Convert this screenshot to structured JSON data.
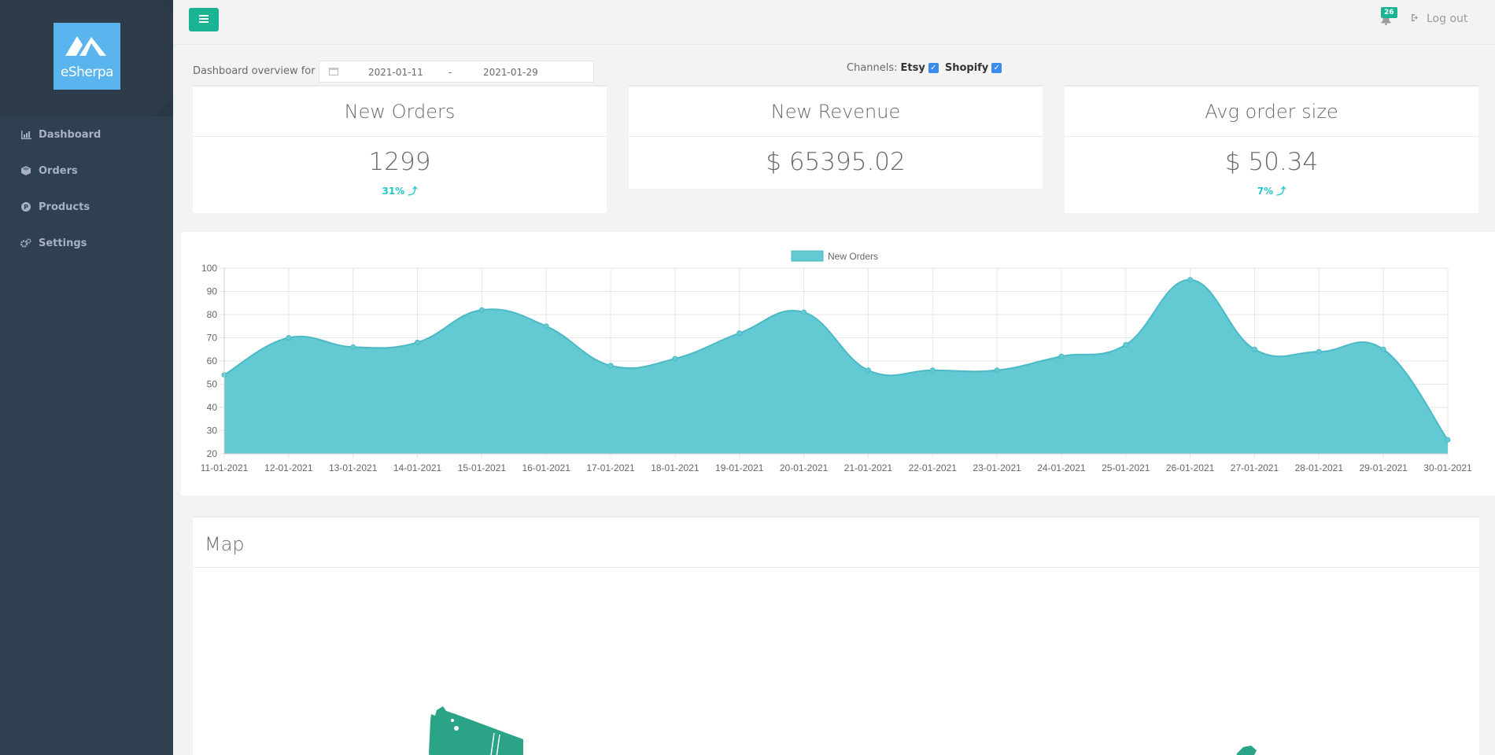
{
  "app": {
    "logo_text": "eSherpa"
  },
  "sidebar": {
    "items": [
      {
        "label": "Dashboard",
        "icon": "bar-chart-icon"
      },
      {
        "label": "Orders",
        "icon": "cube-icon"
      },
      {
        "label": "Products",
        "icon": "product-icon"
      },
      {
        "label": "Settings",
        "icon": "gears-icon"
      }
    ]
  },
  "topbar": {
    "notifications_count": "26",
    "logout_label": "Log out"
  },
  "filter": {
    "label": "Dashboard overview for :",
    "date_from": "2021-01-11",
    "date_separator": "-",
    "date_to": "2021-01-29",
    "channels_label": "Channels:",
    "channels": [
      {
        "name": "Etsy",
        "checked": true
      },
      {
        "name": "Shopify",
        "checked": true
      }
    ]
  },
  "cards": [
    {
      "title": "New Orders",
      "value": "1299",
      "change": "31% ⤴"
    },
    {
      "title": "New Revenue",
      "value": "$ 65395.02",
      "change": ""
    },
    {
      "title": "Avg order size",
      "value": "$ 50.34",
      "change": "7% ⤴"
    }
  ],
  "map": {
    "title": "Map"
  },
  "colors": {
    "accent": "#1ab394",
    "chart_fill": "#63c9d3",
    "chart_line": "#4cbac6",
    "sidebar": "#2f4050",
    "map_fill": "#2ba386"
  },
  "chart_data": {
    "type": "area",
    "legend": "top-center",
    "grid": true,
    "series": [
      {
        "name": "New Orders",
        "values": [
          54,
          70,
          66,
          68,
          82,
          75,
          58,
          61,
          72,
          81,
          56,
          56,
          56,
          62,
          67,
          95,
          65,
          64,
          65,
          26
        ]
      }
    ],
    "categories": [
      "11-01-2021",
      "12-01-2021",
      "13-01-2021",
      "14-01-2021",
      "15-01-2021",
      "16-01-2021",
      "17-01-2021",
      "18-01-2021",
      "19-01-2021",
      "20-01-2021",
      "21-01-2021",
      "22-01-2021",
      "23-01-2021",
      "24-01-2021",
      "25-01-2021",
      "26-01-2021",
      "27-01-2021",
      "28-01-2021",
      "29-01-2021",
      "30-01-2021"
    ],
    "ylim": [
      20,
      100
    ],
    "yticks": [
      20,
      30,
      40,
      50,
      60,
      70,
      80,
      90,
      100
    ]
  }
}
